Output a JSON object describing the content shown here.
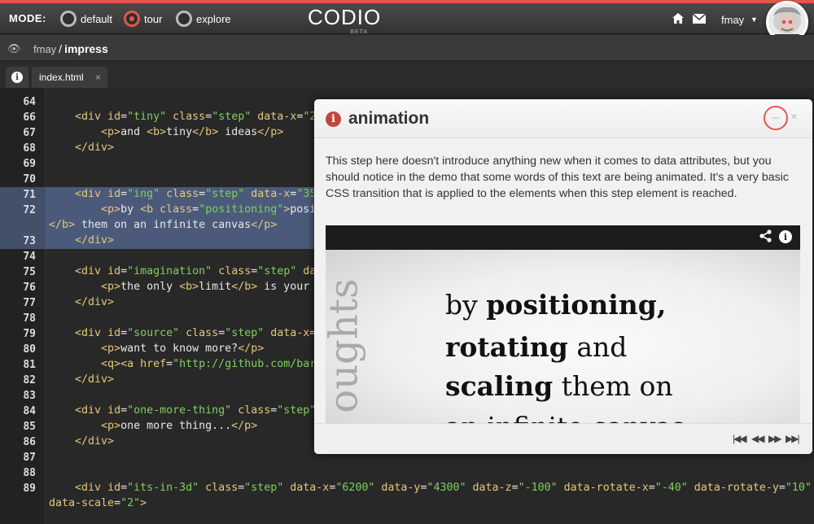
{
  "topbar": {
    "mode_label": "MODE:",
    "modes": [
      {
        "label": "default",
        "selected": false
      },
      {
        "label": "tour",
        "selected": true
      },
      {
        "label": "explore",
        "selected": false
      }
    ],
    "logo": "CODIO",
    "logo_sub": "BETA",
    "username": "fmay",
    "accent_color": "#e4574a"
  },
  "breadcrumb": {
    "owner": "fmay",
    "separator": "/",
    "project": "impress"
  },
  "tabs": [
    {
      "label": "index.html",
      "close": "×"
    }
  ],
  "editor": {
    "lines": [
      {
        "n": "64",
        "code": []
      },
      {
        "n": "66",
        "code": [
          [
            "p",
            "    "
          ],
          [
            "t",
            "<div "
          ],
          [
            "a",
            "id"
          ],
          [
            "p",
            "="
          ],
          [
            "s",
            "\"tiny\""
          ],
          [
            "p",
            " "
          ],
          [
            "a",
            "class"
          ],
          [
            "p",
            "="
          ],
          [
            "s",
            "\"step\""
          ],
          [
            "p",
            " "
          ],
          [
            "a",
            "data-x"
          ],
          [
            "p",
            "="
          ],
          [
            "s",
            "\"2"
          ]
        ]
      },
      {
        "n": "67",
        "code": [
          [
            "p",
            "        "
          ],
          [
            "t",
            "<p>"
          ],
          [
            "p",
            "and "
          ],
          [
            "t",
            "<b>"
          ],
          [
            "p",
            "tiny"
          ],
          [
            "t",
            "</b>"
          ],
          [
            "p",
            " ideas"
          ],
          [
            "t",
            "</p>"
          ]
        ]
      },
      {
        "n": "68",
        "code": [
          [
            "p",
            "    "
          ],
          [
            "t",
            "</div>"
          ]
        ]
      },
      {
        "n": "69",
        "code": []
      },
      {
        "n": "70",
        "code": []
      },
      {
        "n": "71",
        "code": [
          [
            "p",
            "    "
          ],
          [
            "t",
            "<div "
          ],
          [
            "a",
            "id"
          ],
          [
            "p",
            "="
          ],
          [
            "s",
            "\"ing\""
          ],
          [
            "p",
            " "
          ],
          [
            "a",
            "class"
          ],
          [
            "p",
            "="
          ],
          [
            "s",
            "\"step\""
          ],
          [
            "p",
            " "
          ],
          [
            "a",
            "data-x"
          ],
          [
            "p",
            "="
          ],
          [
            "s",
            "\"35"
          ]
        ]
      },
      {
        "n": "72",
        "code": [
          [
            "p",
            "        "
          ],
          [
            "t",
            "<p>"
          ],
          [
            "p",
            "by "
          ],
          [
            "t",
            "<b "
          ],
          [
            "a",
            "class"
          ],
          [
            "p",
            "="
          ],
          [
            "s",
            "\"positioning\""
          ],
          [
            "t",
            ">"
          ],
          [
            "p",
            "posi"
          ]
        ]
      },
      {
        "n": "",
        "code": [
          [
            "t",
            "</b>"
          ],
          [
            "p",
            " them on an infinite canvas"
          ],
          [
            "t",
            "</p>"
          ]
        ]
      },
      {
        "n": "73",
        "code": [
          [
            "p",
            "    "
          ],
          [
            "t",
            "</div>"
          ]
        ]
      },
      {
        "n": "74",
        "code": []
      },
      {
        "n": "75",
        "code": [
          [
            "p",
            "    "
          ],
          [
            "t",
            "<div "
          ],
          [
            "a",
            "id"
          ],
          [
            "p",
            "="
          ],
          [
            "s",
            "\"imagination\""
          ],
          [
            "p",
            " "
          ],
          [
            "a",
            "class"
          ],
          [
            "p",
            "="
          ],
          [
            "s",
            "\"step\""
          ],
          [
            "p",
            " "
          ],
          [
            "a",
            "da"
          ]
        ]
      },
      {
        "n": "76",
        "code": [
          [
            "p",
            "        "
          ],
          [
            "t",
            "<p>"
          ],
          [
            "p",
            "the only "
          ],
          [
            "t",
            "<b>"
          ],
          [
            "p",
            "limit"
          ],
          [
            "t",
            "</b>"
          ],
          [
            "p",
            " is your"
          ]
        ]
      },
      {
        "n": "77",
        "code": [
          [
            "p",
            "    "
          ],
          [
            "t",
            "</div>"
          ]
        ]
      },
      {
        "n": "78",
        "code": []
      },
      {
        "n": "79",
        "code": [
          [
            "p",
            "    "
          ],
          [
            "t",
            "<div "
          ],
          [
            "a",
            "id"
          ],
          [
            "p",
            "="
          ],
          [
            "s",
            "\"source\""
          ],
          [
            "p",
            " "
          ],
          [
            "a",
            "class"
          ],
          [
            "p",
            "="
          ],
          [
            "s",
            "\"step\""
          ],
          [
            "p",
            " "
          ],
          [
            "a",
            "data-x"
          ],
          [
            "p",
            "="
          ]
        ]
      },
      {
        "n": "80",
        "code": [
          [
            "p",
            "        "
          ],
          [
            "t",
            "<p>"
          ],
          [
            "p",
            "want to know more?"
          ],
          [
            "t",
            "</p>"
          ]
        ]
      },
      {
        "n": "81",
        "code": [
          [
            "p",
            "        "
          ],
          [
            "t",
            "<q><a "
          ],
          [
            "a",
            "href"
          ],
          [
            "p",
            "="
          ],
          [
            "s",
            "\"http://github.com/bar"
          ]
        ]
      },
      {
        "n": "82",
        "code": [
          [
            "p",
            "    "
          ],
          [
            "t",
            "</div>"
          ]
        ]
      },
      {
        "n": "83",
        "code": []
      },
      {
        "n": "84",
        "code": [
          [
            "p",
            "    "
          ],
          [
            "t",
            "<div "
          ],
          [
            "a",
            "id"
          ],
          [
            "p",
            "="
          ],
          [
            "s",
            "\"one-more-thing\""
          ],
          [
            "p",
            " "
          ],
          [
            "a",
            "class"
          ],
          [
            "p",
            "="
          ],
          [
            "s",
            "\"step\""
          ]
        ]
      },
      {
        "n": "85",
        "code": [
          [
            "p",
            "        "
          ],
          [
            "t",
            "<p>"
          ],
          [
            "p",
            "one more thing..."
          ],
          [
            "t",
            "</p>"
          ]
        ]
      },
      {
        "n": "86",
        "code": [
          [
            "p",
            "    "
          ],
          [
            "t",
            "</div>"
          ]
        ]
      },
      {
        "n": "87",
        "code": []
      },
      {
        "n": "88",
        "code": []
      },
      {
        "n": "89",
        "code": [
          [
            "p",
            "    "
          ],
          [
            "t",
            "<div "
          ],
          [
            "a",
            "id"
          ],
          [
            "p",
            "="
          ],
          [
            "s",
            "\"its-in-3d\""
          ],
          [
            "p",
            " "
          ],
          [
            "a",
            "class"
          ],
          [
            "p",
            "="
          ],
          [
            "s",
            "\"step\""
          ],
          [
            "p",
            " "
          ],
          [
            "a",
            "data-x"
          ],
          [
            "p",
            "="
          ],
          [
            "s",
            "\"6200\""
          ],
          [
            "p",
            " "
          ],
          [
            "a",
            "data-y"
          ],
          [
            "p",
            "="
          ],
          [
            "s",
            "\"4300\""
          ],
          [
            "p",
            " "
          ],
          [
            "a",
            "data-z"
          ],
          [
            "p",
            "="
          ],
          [
            "s",
            "\"-100\""
          ],
          [
            "p",
            " "
          ],
          [
            "a",
            "data-rotate-x"
          ],
          [
            "p",
            "="
          ],
          [
            "s",
            "\"-40\""
          ],
          [
            "p",
            " "
          ],
          [
            "a",
            "data-rotate-y"
          ],
          [
            "p",
            "="
          ],
          [
            "s",
            "\"10\""
          ]
        ]
      },
      {
        "n": "",
        "code": [
          [
            "a",
            "data-scale"
          ],
          [
            "p",
            "="
          ],
          [
            "s",
            "\"2\""
          ],
          [
            "t",
            ">"
          ]
        ]
      }
    ],
    "highlighted": [
      "71",
      "72",
      "",
      "73"
    ]
  },
  "modal": {
    "title": "animation",
    "minimize": "–",
    "close": "×",
    "body": "This step here doesn't introduce anything new when it comes to data attributes, but you should notice in the demo that some words of this text are being animated. It's a very basic CSS transition that is applied to the elements when this step element is reached.",
    "video": {
      "side_text": "oughts",
      "line1_plain": "by ",
      "line1_bold": "positioning,",
      "line2_bold": "rotating",
      "line2_plain": " and",
      "line3_bold": "scaling",
      "line3_plain": " them on",
      "line4": "an infinite canvas"
    },
    "nav": [
      "first",
      "previous",
      "next",
      "last"
    ]
  }
}
